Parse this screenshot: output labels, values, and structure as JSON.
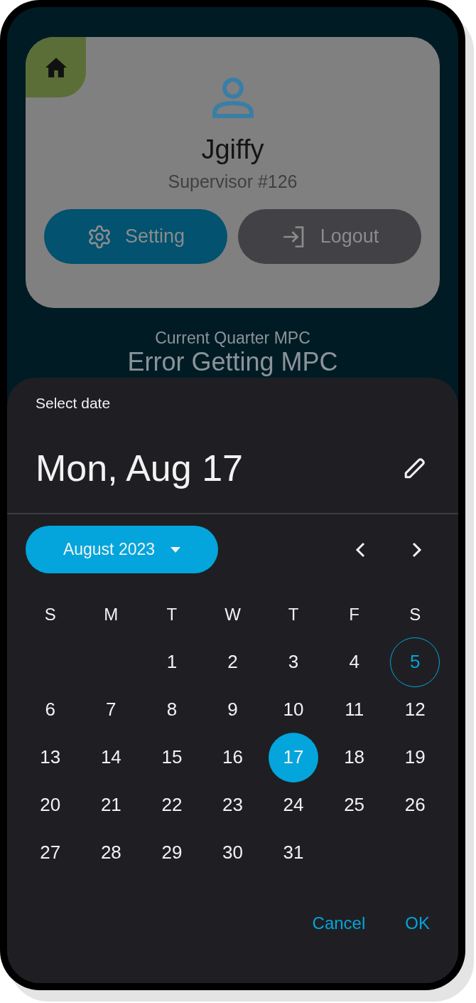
{
  "profile": {
    "name": "Jgiffy",
    "role": "Supervisor #126",
    "buttons": [
      {
        "label": "Setting",
        "kind": "primary"
      },
      {
        "label": "Logout",
        "kind": "secondary"
      }
    ]
  },
  "mpc": {
    "label": "Current Quarter MPC",
    "value": "Error Getting MPC"
  },
  "date_picker": {
    "title": "Select date",
    "headline": "Mon, Aug 17",
    "month": "August 2023",
    "weekdays": [
      "S",
      "M",
      "T",
      "W",
      "T",
      "F",
      "S"
    ],
    "days": [
      {
        "kind": "blank"
      },
      {
        "kind": "blank"
      },
      {
        "kind": "day",
        "label": "1",
        "selected": false,
        "today": false
      },
      {
        "kind": "day",
        "label": "2",
        "selected": false,
        "today": false
      },
      {
        "kind": "day",
        "label": "3",
        "selected": false,
        "today": false
      },
      {
        "kind": "day",
        "label": "4",
        "selected": false,
        "today": false
      },
      {
        "kind": "day",
        "label": "5",
        "selected": false,
        "today": true
      },
      {
        "kind": "day",
        "label": "6",
        "selected": false,
        "today": false
      },
      {
        "kind": "day",
        "label": "7",
        "selected": false,
        "today": false
      },
      {
        "kind": "day",
        "label": "8",
        "selected": false,
        "today": false
      },
      {
        "kind": "day",
        "label": "9",
        "selected": false,
        "today": false
      },
      {
        "kind": "day",
        "label": "10",
        "selected": false,
        "today": false
      },
      {
        "kind": "day",
        "label": "11",
        "selected": false,
        "today": false
      },
      {
        "kind": "day",
        "label": "12",
        "selected": false,
        "today": false
      },
      {
        "kind": "day",
        "label": "13",
        "selected": false,
        "today": false
      },
      {
        "kind": "day",
        "label": "14",
        "selected": false,
        "today": false
      },
      {
        "kind": "day",
        "label": "15",
        "selected": false,
        "today": false
      },
      {
        "kind": "day",
        "label": "16",
        "selected": false,
        "today": false
      },
      {
        "kind": "day",
        "label": "17",
        "selected": true,
        "today": false
      },
      {
        "kind": "day",
        "label": "18",
        "selected": false,
        "today": false
      },
      {
        "kind": "day",
        "label": "19",
        "selected": false,
        "today": false
      },
      {
        "kind": "day",
        "label": "20",
        "selected": false,
        "today": false
      },
      {
        "kind": "day",
        "label": "21",
        "selected": false,
        "today": false
      },
      {
        "kind": "day",
        "label": "22",
        "selected": false,
        "today": false
      },
      {
        "kind": "day",
        "label": "23",
        "selected": false,
        "today": false
      },
      {
        "kind": "day",
        "label": "24",
        "selected": false,
        "today": false
      },
      {
        "kind": "day",
        "label": "25",
        "selected": false,
        "today": false
      },
      {
        "kind": "day",
        "label": "26",
        "selected": false,
        "today": false
      },
      {
        "kind": "day",
        "label": "27",
        "selected": false,
        "today": false
      },
      {
        "kind": "day",
        "label": "28",
        "selected": false,
        "today": false
      },
      {
        "kind": "day",
        "label": "29",
        "selected": false,
        "today": false
      },
      {
        "kind": "day",
        "label": "30",
        "selected": false,
        "today": false
      },
      {
        "kind": "day",
        "label": "31",
        "selected": false,
        "today": false
      }
    ],
    "actions": [
      "Cancel",
      "OK"
    ]
  }
}
